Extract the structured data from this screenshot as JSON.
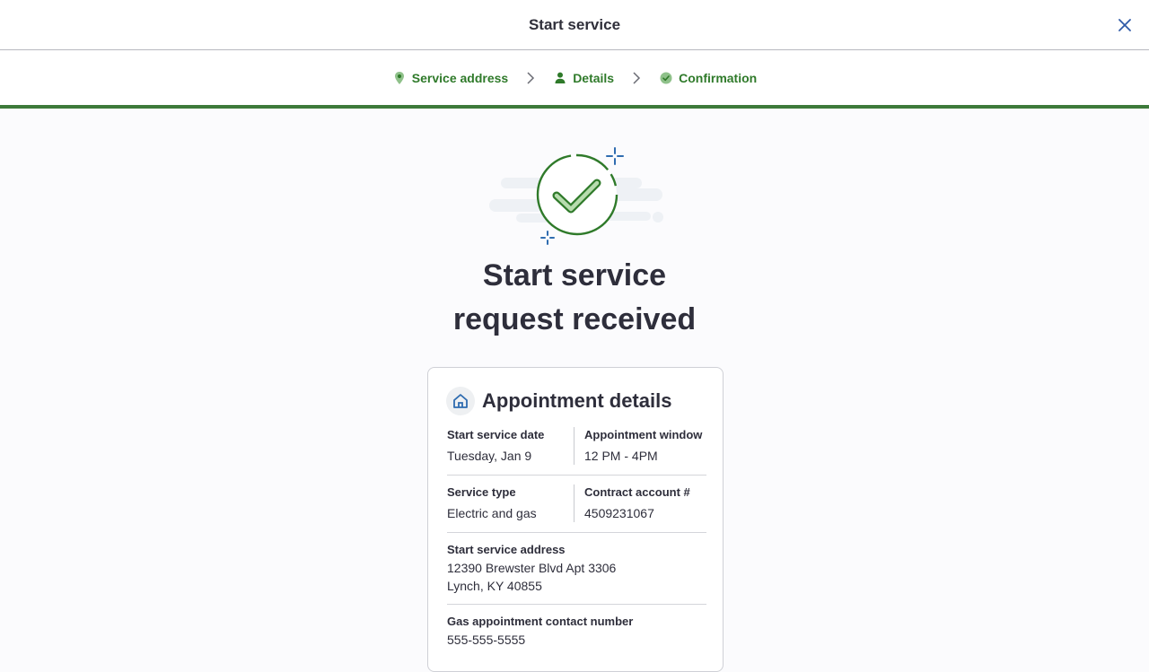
{
  "header": {
    "title": "Start service"
  },
  "stepper": {
    "steps": [
      {
        "label": "Service address",
        "icon": "location-pin-icon"
      },
      {
        "label": "Details",
        "icon": "person-icon"
      },
      {
        "label": "Confirmation",
        "icon": "check-circle-icon"
      }
    ],
    "progress_fraction": 1.0,
    "accent_color": "#2f7a2a"
  },
  "hero": {
    "icon": "success-checkmark-illustration",
    "headline_line1": "Start service",
    "headline_line2": "request received"
  },
  "card": {
    "icon": "house-icon",
    "title": "Appointment details",
    "start_date_label": "Start service date",
    "start_date_value": "Tuesday, Jan 9",
    "window_label": "Appointment window",
    "window_value": "12 PM - 4PM",
    "service_type_label": "Service type",
    "service_type_value": "Electric and gas",
    "account_label": "Contract account #",
    "account_value": "4509231067",
    "address_label": "Start service address",
    "address_line1": "12390 Brewster Blvd Apt 3306",
    "address_line2": "Lynch, KY 40855",
    "gas_contact_label": "Gas appointment contact number",
    "gas_contact_value": "555-555-5555"
  }
}
